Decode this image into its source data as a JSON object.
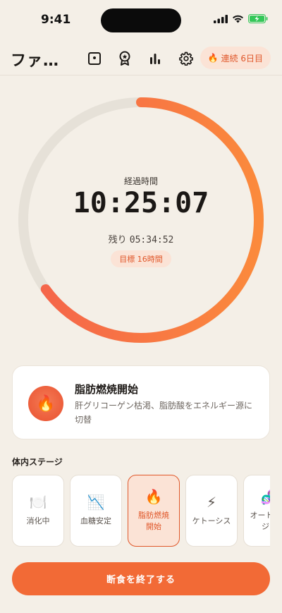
{
  "status": {
    "time": "9:41"
  },
  "header": {
    "title": "ファ…",
    "streak_label": "連続 6日目"
  },
  "timer": {
    "elapsed_label": "経過時間",
    "elapsed": "10:25:07",
    "remaining_prefix": "残り",
    "remaining": "05:34:52",
    "goal": "目標 16時間",
    "progress": 0.65
  },
  "current_stage": {
    "icon": "fire-icon",
    "title": "脂肪燃焼開始",
    "description": "肝グリコーゲン枯渇、脂肪酸をエネルギー源に切替"
  },
  "stages_section": {
    "title": "体内ステージ",
    "items": [
      {
        "label": "消化中",
        "icon": "plate-icon",
        "emoji": "🍽️",
        "active": false
      },
      {
        "label": "血糖安定",
        "icon": "chart-down-icon",
        "emoji": "📉",
        "active": false
      },
      {
        "label": "脂肪燃焼\n開始",
        "icon": "fire-icon",
        "emoji": "🔥",
        "active": true
      },
      {
        "label": "ケトーシス",
        "icon": "lightning-icon",
        "emoji": "⚡",
        "active": false
      },
      {
        "label": "オートファ\nジー",
        "icon": "dna-icon",
        "emoji": "🧬",
        "active": false
      }
    ]
  },
  "actions": {
    "end_fast": "断食を終了する"
  },
  "colors": {
    "accent": "#f26a36",
    "ring_track": "#e6e1d8",
    "background": "#f4efe7"
  }
}
